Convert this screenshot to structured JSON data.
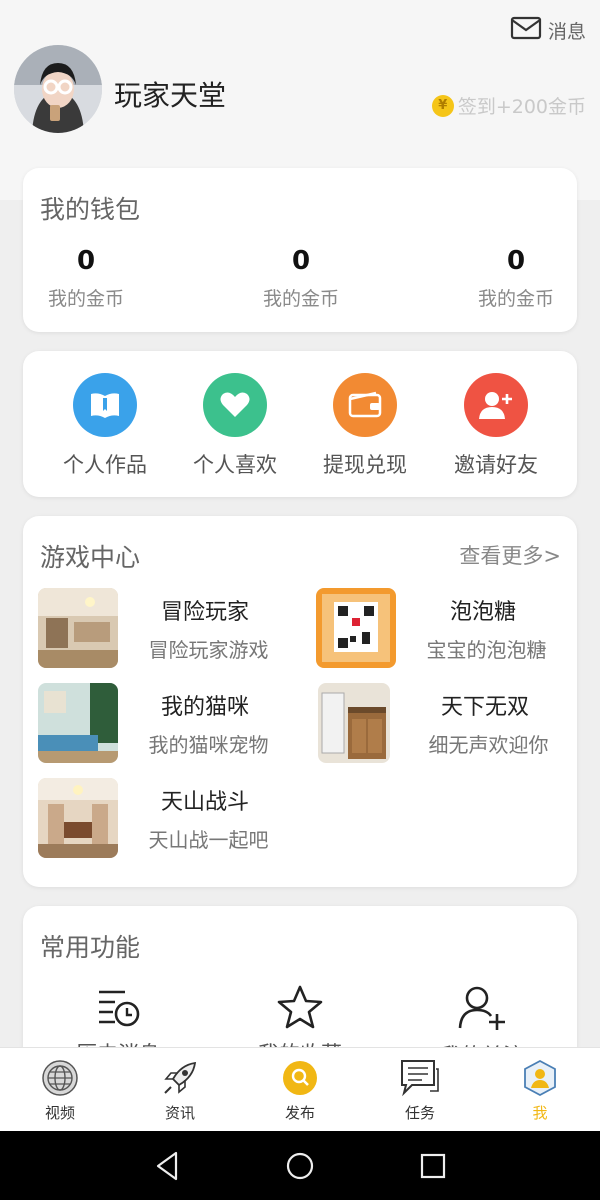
{
  "header": {
    "messages_label": "消息",
    "username": "玩家天堂",
    "checkin_label": "签到+200金币",
    "coin_symbol": "¥"
  },
  "wallet": {
    "title": "我的钱包",
    "items": [
      {
        "value": "0",
        "label": "我的金币"
      },
      {
        "value": "0",
        "label": "我的金币"
      },
      {
        "value": "0",
        "label": "我的金币"
      }
    ]
  },
  "quick_actions": [
    {
      "label": "个人作品",
      "icon": "book-icon",
      "color": "#3aa2ea"
    },
    {
      "label": "个人喜欢",
      "icon": "heart-icon",
      "color": "#3cc18d"
    },
    {
      "label": "提现兑现",
      "icon": "wallet-icon",
      "color": "#f28a33"
    },
    {
      "label": "邀请好友",
      "icon": "add-user-icon",
      "color": "#ef5343"
    }
  ],
  "games": {
    "title": "游戏中心",
    "more": "查看更多>",
    "items": [
      {
        "name": "冒险玩家",
        "desc": "冒险玩家游戏"
      },
      {
        "name": "泡泡糖",
        "desc": "宝宝的泡泡糖"
      },
      {
        "name": "我的猫咪",
        "desc": "我的猫咪宠物"
      },
      {
        "name": "天下无双",
        "desc": "细无声欢迎你"
      },
      {
        "name": "天山战斗",
        "desc": "天山战一起吧"
      }
    ]
  },
  "common": {
    "title": "常用功能",
    "items": [
      {
        "label": "历史消息",
        "icon": "history-icon"
      },
      {
        "label": "我的收藏",
        "icon": "star-icon"
      },
      {
        "label": "我的关注",
        "icon": "follow-user-icon"
      }
    ]
  },
  "bottom_nav": [
    {
      "label": "视频",
      "icon": "globe-icon"
    },
    {
      "label": "资讯",
      "icon": "rocket-icon"
    },
    {
      "label": "发布",
      "icon": "search-icon"
    },
    {
      "label": "任务",
      "icon": "chat-list-icon"
    },
    {
      "label": "我",
      "icon": "profile-icon",
      "active": true
    }
  ],
  "colors": {
    "accent": "#f1b714",
    "page_bg": "#efefef"
  }
}
